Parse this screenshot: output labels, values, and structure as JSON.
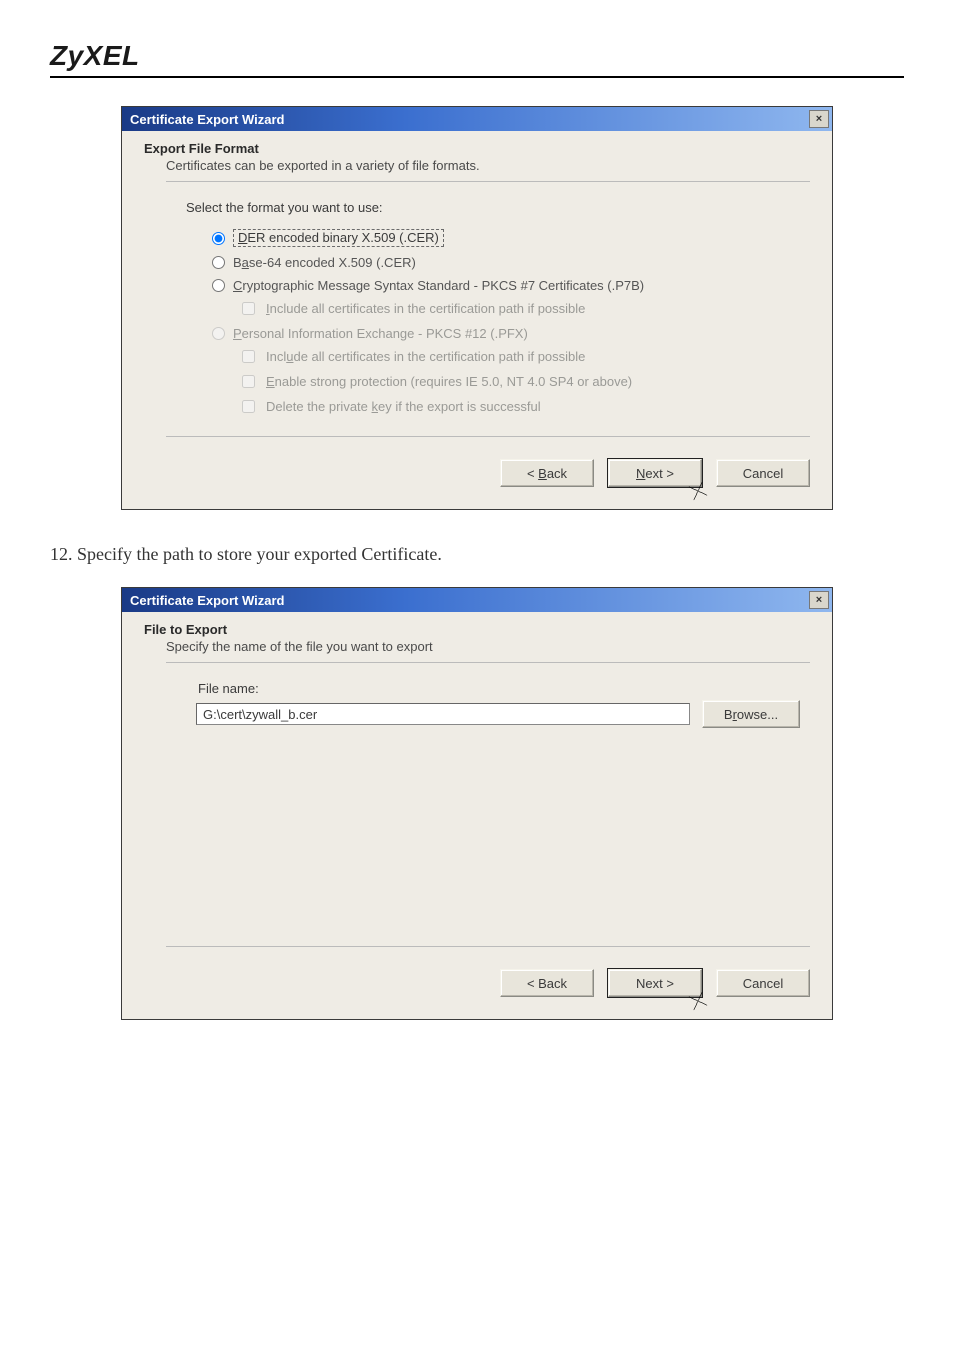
{
  "brand": "ZyXEL",
  "dialog1": {
    "title": "Certificate Export Wizard",
    "close_label": "×",
    "heading": "Export File Format",
    "subheading": "Certificates can be exported in a variety of file formats.",
    "prompt": "Select the format you want to use:",
    "options": {
      "der": {
        "label_pre": "",
        "hotkey": "D",
        "label_post": "ER encoded binary X.509 (.CER)"
      },
      "base64": {
        "label_pre": "B",
        "hotkey": "a",
        "label_post": "se-64 encoded X.509 (.CER)"
      },
      "p7b": {
        "label_pre": "",
        "hotkey": "C",
        "label_post": "ryptographic Message Syntax Standard - PKCS #7 Certificates (.P7B)"
      },
      "p7b_inc": {
        "label_pre": "",
        "hotkey": "I",
        "label_post": "nclude all certificates in the certification path if possible"
      },
      "pfx": {
        "label_pre": "",
        "hotkey": "P",
        "label_post": "ersonal Information Exchange - PKCS #12 (.PFX)"
      },
      "pfx_inc": {
        "label_pre": "Incl",
        "hotkey": "u",
        "label_post": "de all certificates in the certification path if possible"
      },
      "pfx_strong": {
        "label_pre": "",
        "hotkey": "E",
        "label_post": "nable strong protection (requires IE 5.0, NT 4.0 SP4 or above)"
      },
      "pfx_delkey": {
        "label_pre": "Delete the private ",
        "hotkey": "k",
        "label_post": "ey if the export is successful"
      }
    },
    "buttons": {
      "back_pre": "< ",
      "back_hot": "B",
      "back_post": "ack",
      "next_pre": "",
      "next_hot": "N",
      "next_post": "ext >",
      "cancel": "Cancel"
    }
  },
  "step12": "12. Specify the path to store your exported Certificate.",
  "dialog2": {
    "title": "Certificate Export Wizard",
    "close_label": "×",
    "heading": "File to Export",
    "subheading": "Specify the name of the file you want to export",
    "file_label": "File name:",
    "file_value": "G:\\cert\\zywall_b.cer",
    "browse_hot": "r",
    "browse_pre": "B",
    "browse_post": "owse...",
    "buttons": {
      "back": "< Back",
      "next": "Next >",
      "cancel": "Cancel"
    }
  }
}
